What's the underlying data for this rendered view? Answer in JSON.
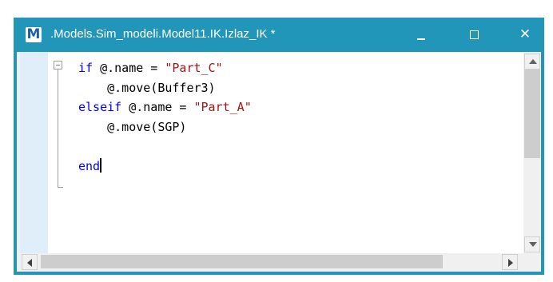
{
  "window": {
    "title": ".Models.Sim_modeli.Model11.IK.Izlaz_IK *",
    "logo_letter": "M",
    "controls": {
      "minimize_icon": "minimize-icon",
      "maximize_icon": "maximize-icon",
      "close_icon": "close-icon",
      "close_glyph": "✕"
    },
    "accent_color": "#2196b9"
  },
  "editor": {
    "lines": [
      [
        {
          "t": "if ",
          "c": "kw"
        },
        {
          "t": "@.name = ",
          "c": "plain"
        },
        {
          "t": "\"Part_C\"",
          "c": "str"
        }
      ],
      [
        {
          "t": "    @.move(Buffer3)",
          "c": "plain"
        }
      ],
      [
        {
          "t": "elseif ",
          "c": "kw"
        },
        {
          "t": "@.name = ",
          "c": "plain"
        },
        {
          "t": "\"Part_A\"",
          "c": "str"
        }
      ],
      [
        {
          "t": "    @.move(SGP)",
          "c": "plain"
        }
      ],
      [
        {
          "t": "",
          "c": "plain"
        }
      ],
      [
        {
          "t": "end",
          "c": "kw"
        }
      ]
    ],
    "caret_after_line": 5,
    "colors": {
      "keyword": "#0000ff",
      "string": "#a31515",
      "gutter": "#dfeef8"
    }
  },
  "scrollbars": {
    "vertical": {
      "up_icon": "scroll-up-arrow-icon",
      "down_icon": "scroll-down-arrow-icon"
    },
    "horizontal": {
      "left_icon": "scroll-left-arrow-icon",
      "right_icon": "scroll-right-arrow-icon"
    }
  }
}
